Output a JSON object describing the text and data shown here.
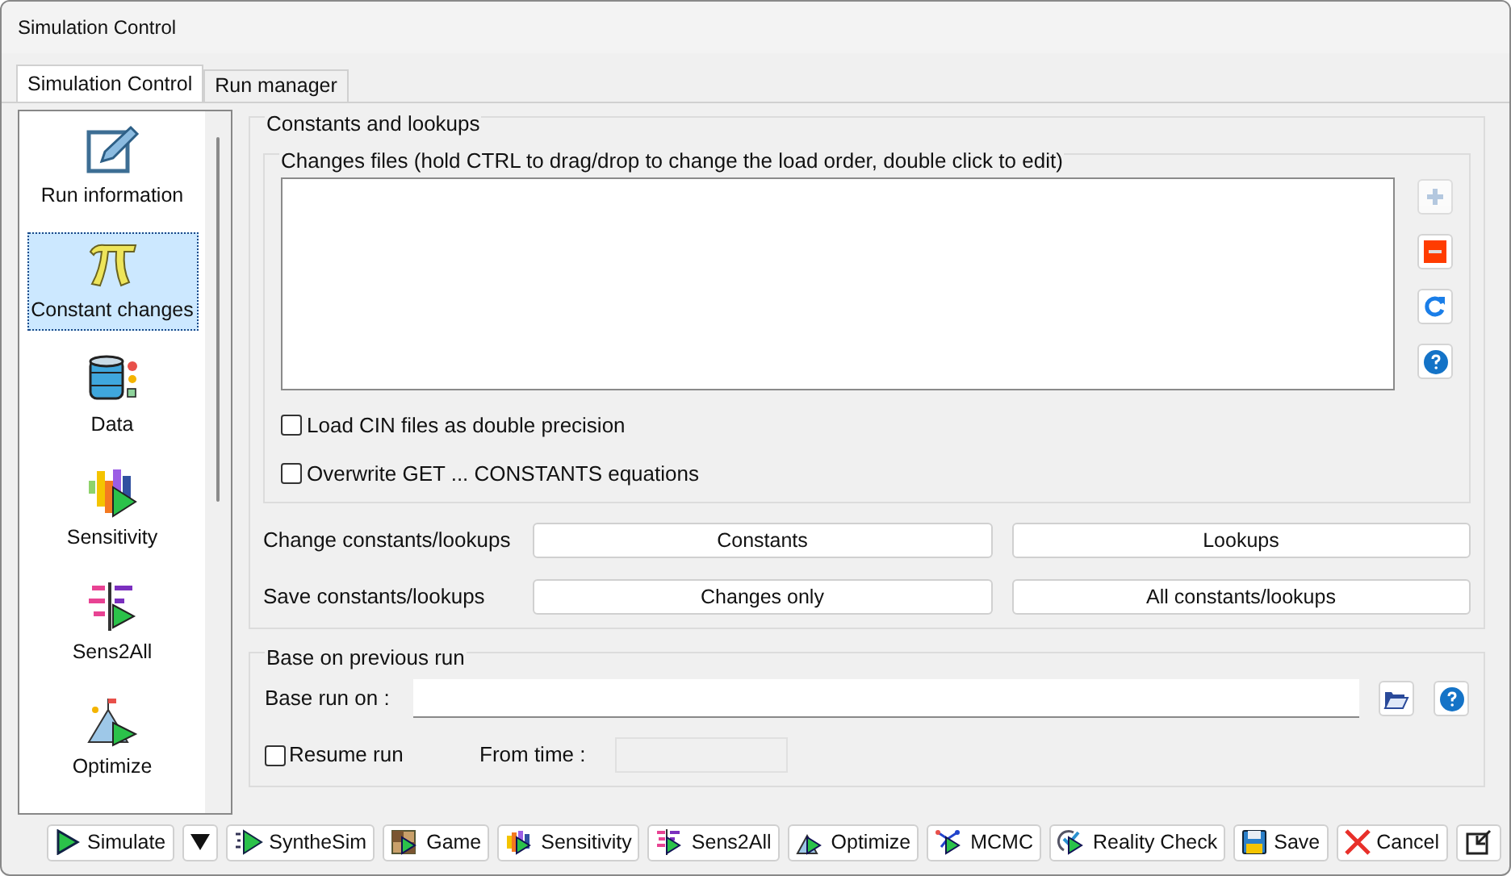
{
  "window": {
    "title": "Simulation Control"
  },
  "tabs": [
    {
      "label": "Simulation Control",
      "selected": true
    },
    {
      "label": "Run manager",
      "selected": false
    }
  ],
  "sidebar": {
    "items": [
      {
        "kind": "edit",
        "label": "Run information",
        "selected": false
      },
      {
        "kind": "pi",
        "label": "Constant changes",
        "selected": true
      },
      {
        "kind": "data",
        "label": "Data",
        "selected": false
      },
      {
        "kind": "sensitivity",
        "label": "Sensitivity",
        "selected": false
      },
      {
        "kind": "sens2all",
        "label": "Sens2All",
        "selected": false
      },
      {
        "kind": "optimize",
        "label": "Optimize",
        "selected": false
      }
    ]
  },
  "constants_group": {
    "title": "Constants and lookups",
    "changes_files": {
      "title": "Changes files (hold CTRL to drag/drop to change the load order, double click to edit)",
      "side_buttons": [
        {
          "kind": "add",
          "disabled": true
        },
        {
          "kind": "remove",
          "disabled": false
        },
        {
          "kind": "refresh",
          "disabled": false
        },
        {
          "kind": "help",
          "disabled": false
        }
      ],
      "checkboxes": [
        {
          "label": "Load CIN files as double precision",
          "checked": false
        },
        {
          "label": "Overwrite GET ... CONSTANTS equations",
          "checked": false
        }
      ]
    },
    "rows": [
      {
        "label": "Change constants/lookups",
        "buttons": [
          "Constants",
          "Lookups"
        ]
      },
      {
        "label": "Save constants/lookups",
        "buttons": [
          "Changes only",
          "All constants/lookups"
        ]
      }
    ]
  },
  "base_group": {
    "title": "Base on previous run",
    "base_run_label": "Base run on :",
    "resume": {
      "label": "Resume run",
      "checked": false
    },
    "from_time_label": "From time :"
  },
  "toolbar": [
    {
      "kind": "simulate",
      "label": "Simulate"
    },
    {
      "kind": "dropdown"
    },
    {
      "kind": "synthesim",
      "label": "SyntheSim"
    },
    {
      "kind": "game",
      "label": "Game"
    },
    {
      "kind": "sensitivity",
      "label": "Sensitivity"
    },
    {
      "kind": "sens2all",
      "label": "Sens2All"
    },
    {
      "kind": "optimize",
      "label": "Optimize"
    },
    {
      "kind": "mcmc",
      "label": "MCMC"
    },
    {
      "kind": "reality",
      "label": "Reality Check"
    },
    {
      "kind": "save",
      "label": "Save"
    },
    {
      "kind": "cancel",
      "label": "Cancel"
    },
    {
      "kind": "detach"
    }
  ]
}
